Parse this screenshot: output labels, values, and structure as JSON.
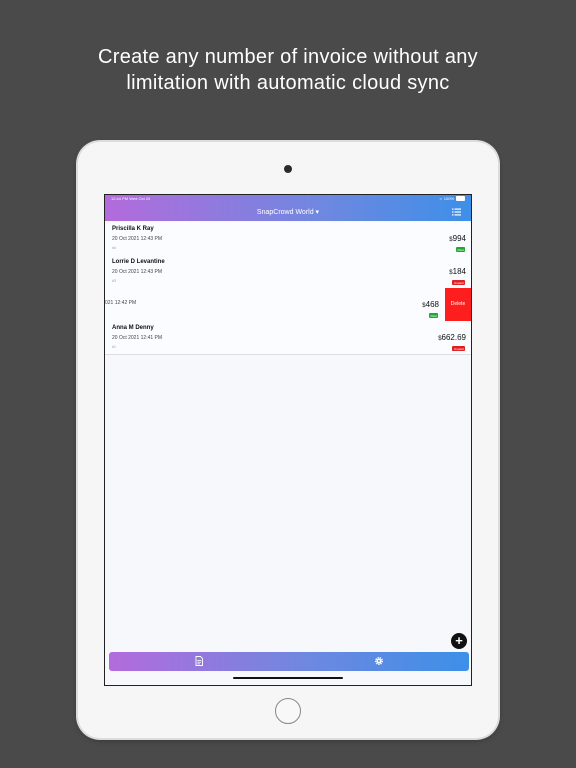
{
  "headline": {
    "line1": "Create any number of invoice without any",
    "line2": "limitation with automatic cloud sync"
  },
  "status_bar": {
    "time": "12:44 PM   Wed Oct 20",
    "battery": "100%"
  },
  "nav": {
    "title": "SnapCrowd World ▾",
    "menu_icon": "list-icon"
  },
  "invoices": [
    {
      "name": "Priscilla K Ray",
      "date": "20 Oct 2021 12:43 PM",
      "number": "#4",
      "currency": "$",
      "amount": "994",
      "status": "Paid",
      "status_color": "#1faa2e"
    },
    {
      "name": "Lorrie D Levantine",
      "date": "20 Oct 2021 12:43 PM",
      "number": "#3",
      "currency": "$",
      "amount": "184",
      "status": "Unpaid",
      "status_color": "#e02020"
    },
    {
      "name": "",
      "date": "021 12:42 PM",
      "number": "",
      "currency": "$",
      "amount": "468",
      "status": "Paid",
      "status_color": "#1faa2e",
      "delete_label": "Delete"
    },
    {
      "name": "Anna M Denny",
      "date": "20 Oct 2021 12:41 PM",
      "number": "#1",
      "currency": "$",
      "amount": "662.69",
      "status": "Unpaid",
      "status_color": "#e02020"
    }
  ],
  "fab": {
    "icon": "plus-circle-icon"
  },
  "tabs": [
    {
      "icon": "document-icon"
    },
    {
      "icon": "gear-icon"
    }
  ]
}
